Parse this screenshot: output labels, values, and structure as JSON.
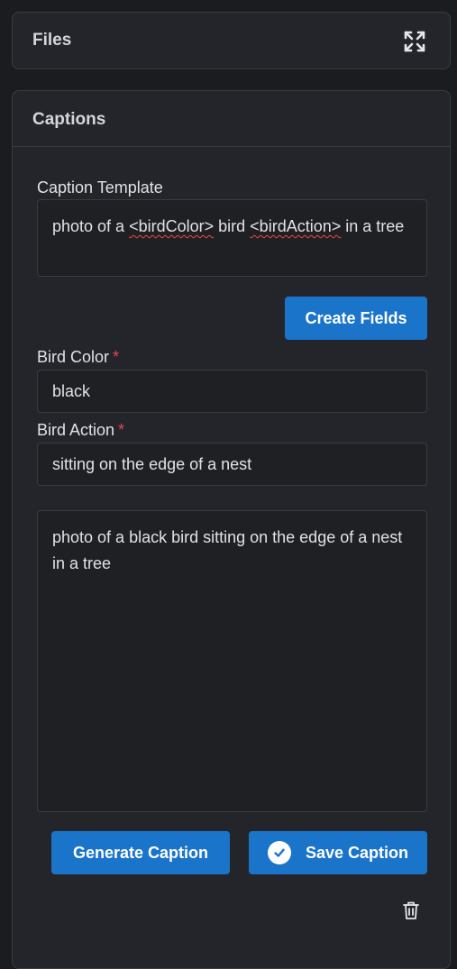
{
  "files_panel": {
    "title": "Files",
    "expand_icon": "expand-arrows-icon"
  },
  "captions_panel": {
    "title": "Captions",
    "template": {
      "label": "Caption Template",
      "value_parts": [
        "photo of a ",
        "<birdColor>",
        " bird ",
        "<birdAction>",
        " in a tree"
      ]
    },
    "create_fields_label": "Create Fields",
    "fields": [
      {
        "label": "Bird Color",
        "required_mark": "*",
        "value": "black"
      },
      {
        "label": "Bird Action",
        "required_mark": "*",
        "value": "sitting on the edge of a nest"
      }
    ],
    "result_text": "photo of a black bird sitting on the edge of a nest in a tree",
    "generate_label": "Generate Caption",
    "save_label": "Save Caption",
    "save_icon": "check-circle-icon",
    "delete_icon": "trash-icon"
  },
  "colors": {
    "background": "#1b1c1f",
    "panel": "#24252a",
    "field_bg": "#1f2024",
    "border": "#3a3b41",
    "accent": "#1a74c9",
    "required": "#e5484d"
  }
}
